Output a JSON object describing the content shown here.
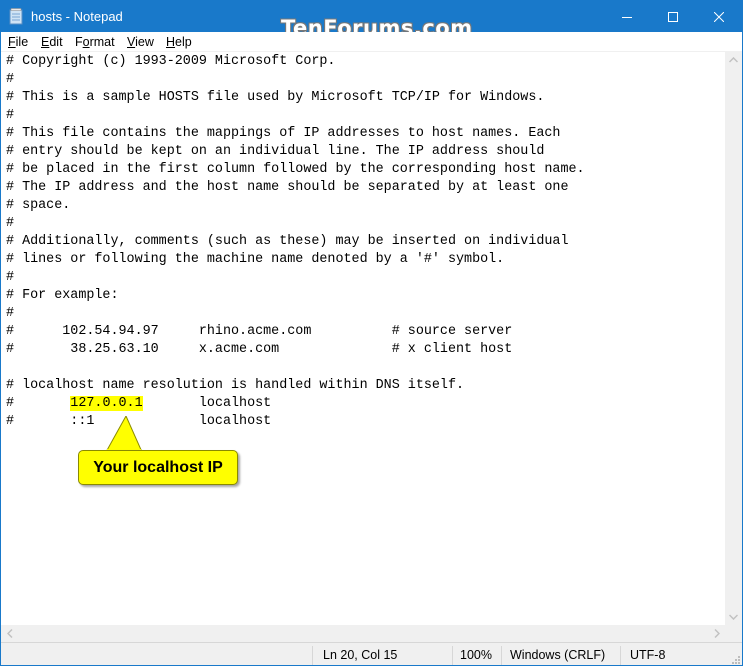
{
  "window": {
    "title": "hosts - Notepad",
    "watermark": "TenForums.com",
    "controls": {
      "minimize": "minimize-icon",
      "maximize": "maximize-icon",
      "close": "close-icon"
    }
  },
  "menu": {
    "items": [
      {
        "label": "File",
        "accel": "F",
        "rest": "ile"
      },
      {
        "label": "Edit",
        "accel": "E",
        "rest": "dit"
      },
      {
        "label": "Format",
        "accel": "o",
        "pre": "F",
        "rest": "rmat"
      },
      {
        "label": "View",
        "accel": "V",
        "rest": "iew"
      },
      {
        "label": "Help",
        "accel": "H",
        "rest": "elp"
      }
    ]
  },
  "editor": {
    "lines": [
      "# Copyright (c) 1993-2009 Microsoft Corp.",
      "#",
      "# This is a sample HOSTS file used by Microsoft TCP/IP for Windows.",
      "#",
      "# This file contains the mappings of IP addresses to host names. Each",
      "# entry should be kept on an individual line. The IP address should",
      "# be placed in the first column followed by the corresponding host name.",
      "# The IP address and the host name should be separated by at least one",
      "# space.",
      "#",
      "# Additionally, comments (such as these) may be inserted on individual",
      "# lines or following the machine name denoted by a '#' symbol.",
      "#",
      "# For example:",
      "#",
      "#      102.54.94.97     rhino.acme.com          # source server",
      "#       38.25.63.10     x.acme.com              # x client host",
      "",
      "# localhost name resolution is handled within DNS itself.",
      {
        "prefix": "#       ",
        "highlight": "127.0.0.1",
        "suffix": "       localhost"
      },
      "#       ::1             localhost"
    ],
    "highlight_color": "#ffff00"
  },
  "callout": {
    "text": "Your localhost IP",
    "color": "#ffff00"
  },
  "statusbar": {
    "position": "Ln 20, Col 15",
    "zoom": "100%",
    "line_ending": "Windows (CRLF)",
    "encoding": "UTF-8"
  },
  "colors": {
    "titlebar": "#1979ca",
    "chrome": "#f0f0f0"
  }
}
